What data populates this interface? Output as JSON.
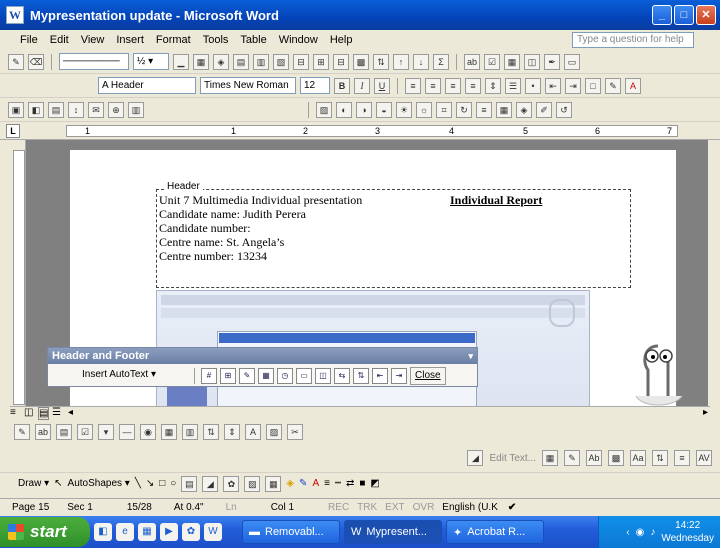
{
  "window": {
    "title": "Mypresentation update - Microsoft Word"
  },
  "menu": {
    "items": [
      "File",
      "Edit",
      "View",
      "Insert",
      "Format",
      "Tools",
      "Table",
      "Window",
      "Help"
    ],
    "help_placeholder": "Type a question for help"
  },
  "formatting": {
    "style": "Header",
    "font": "Times New Roman",
    "size": "12",
    "bold": "B",
    "italic": "I",
    "underline": "U"
  },
  "ruler": {
    "numbers": [
      "1",
      "1",
      "2",
      "3",
      "4",
      "5",
      "6",
      "7"
    ]
  },
  "header": {
    "label": "Header",
    "line1": "Unit 7 Multimedia Individual presentation",
    "report_title": "Individual Report",
    "candidate_name": "Candidate name: Judith Perera",
    "candidate_number": "Candidate number:",
    "centre_name": "Centre name: St. Angela’s",
    "centre_number": "Centre number: 13234"
  },
  "hf_toolbar": {
    "title": "Header and Footer",
    "insert_autotext": "Insert AutoText ▾",
    "close": "Close"
  },
  "edit_row": {
    "edit_text": "Edit Text..."
  },
  "drawbar": {
    "draw": "Draw ▾",
    "autoshapes": "AutoShapes ▾"
  },
  "status": {
    "page": "Page 15",
    "sec": "Sec 1",
    "pages": "15/28",
    "at": "At 0.4\"",
    "ln": "Ln",
    "col": "Col 1",
    "rec": "REC",
    "trk": "TRK",
    "ext": "EXT",
    "ovr": "OVR",
    "lang": "English (U.K"
  },
  "taskbar": {
    "start": "start",
    "tasks": [
      "Removabl...",
      "Mypresent...",
      "Acrobat R..."
    ],
    "time": "14:22",
    "day": "Wednesday"
  }
}
